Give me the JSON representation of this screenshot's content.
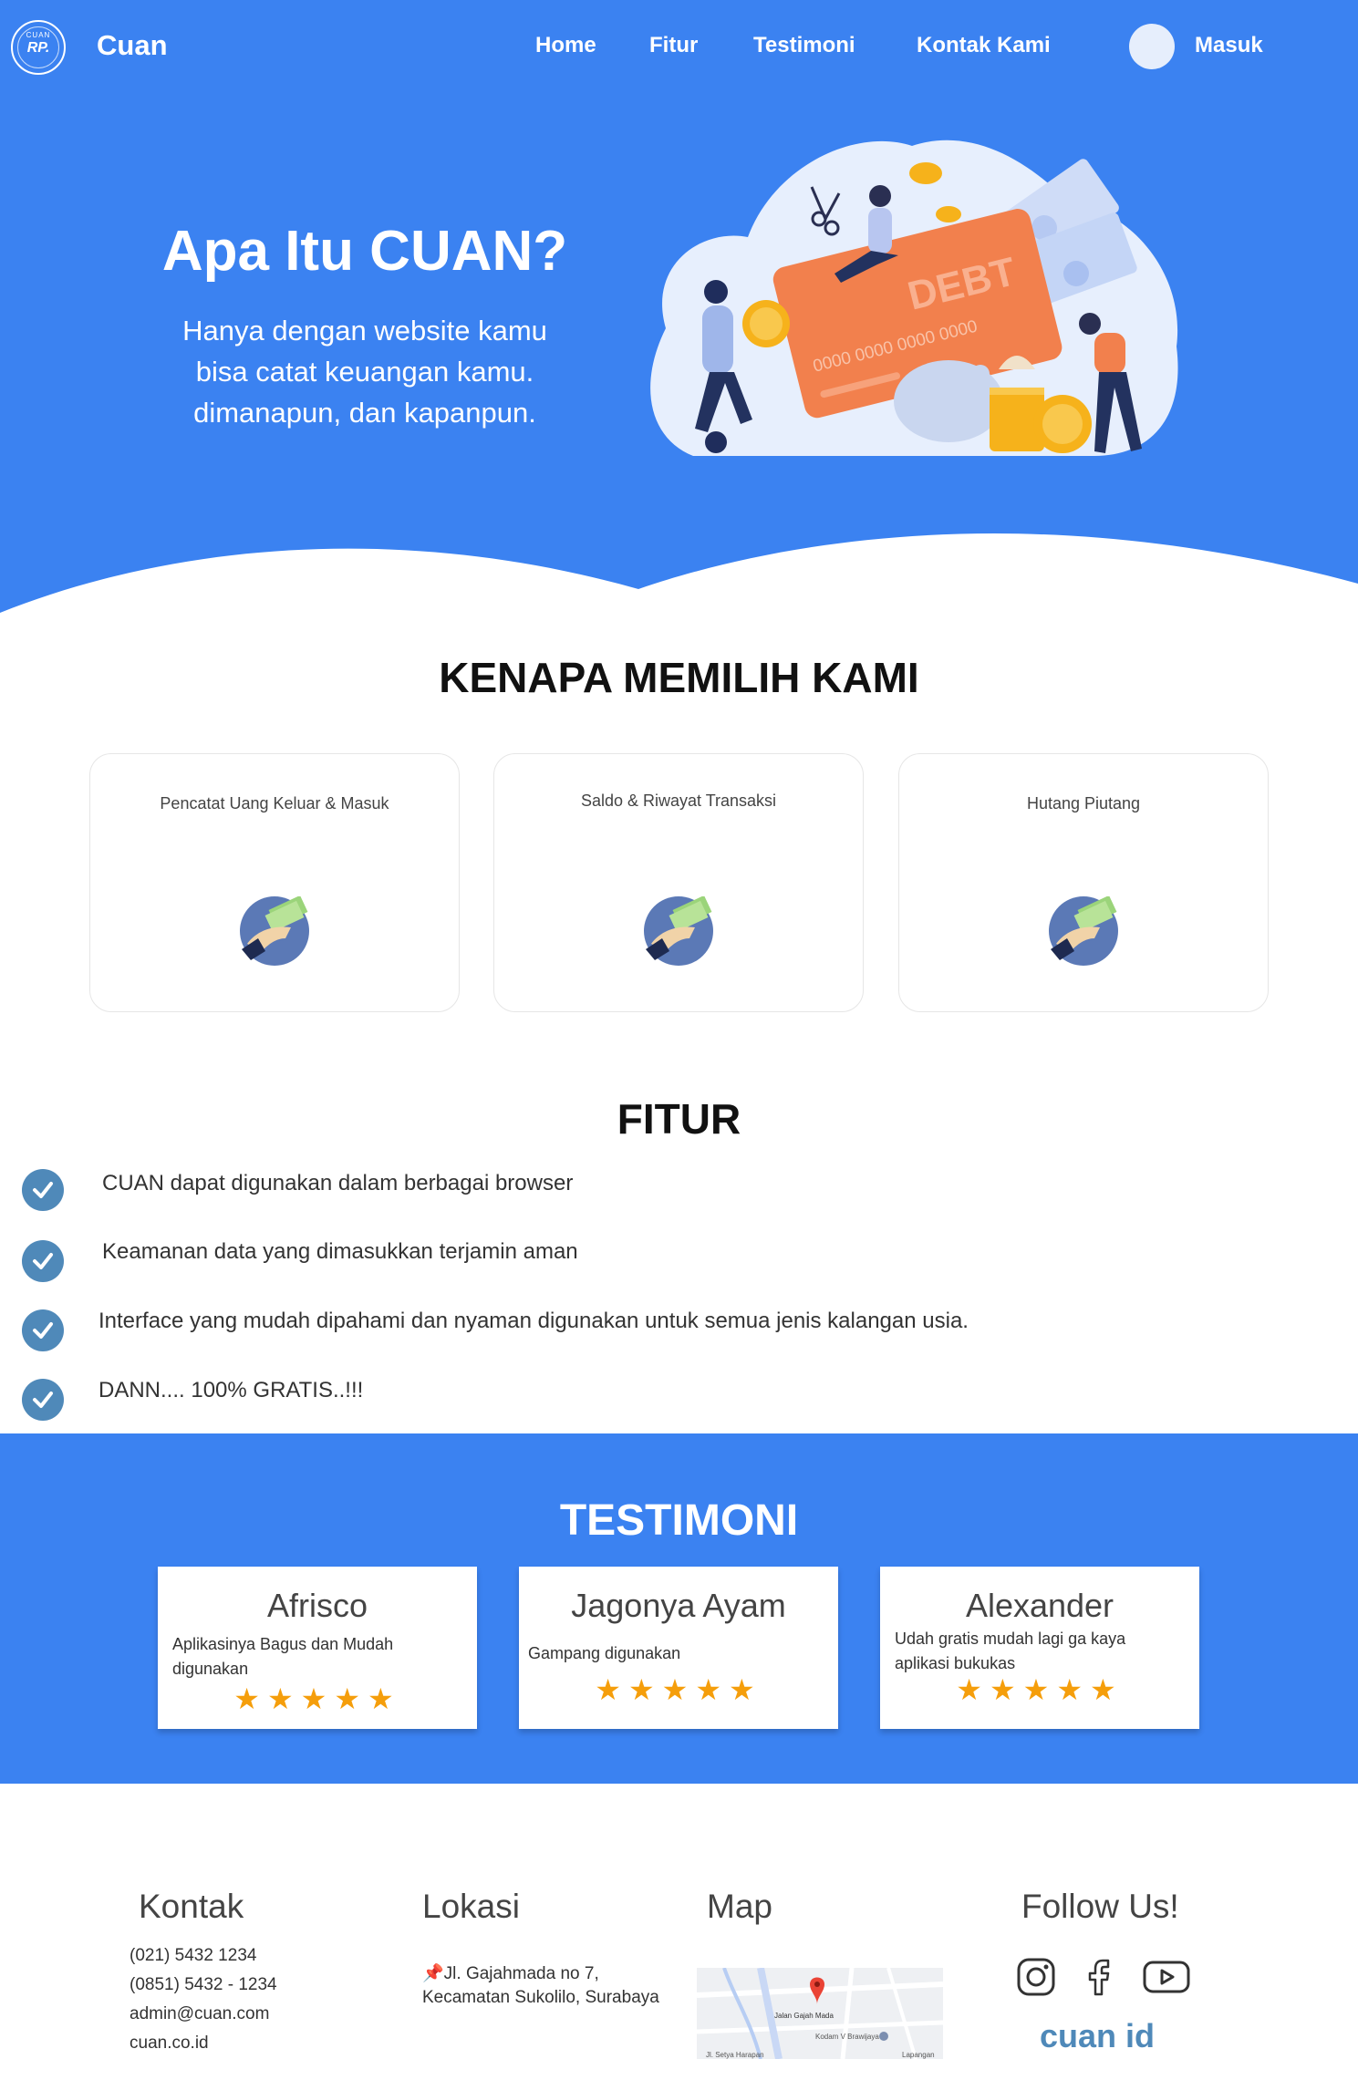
{
  "nav": {
    "logo_top": "CUAN",
    "logo_mid": "RP.",
    "brand": "Cuan",
    "links": [
      "Home",
      "Fitur",
      "Testimoni",
      "Kontak Kami"
    ],
    "login": "Masuk"
  },
  "hero": {
    "title": "Apa Itu CUAN?",
    "lines": [
      "Hanya dengan website kamu",
      "bisa catat keuangan kamu.",
      "dimanapun, dan kapanpun."
    ],
    "card_text": "DEBT",
    "card_number": "0000 0000 0000 0000"
  },
  "why": {
    "title": "KENAPA MEMILIH KAMI",
    "cards": [
      "Pencatat Uang Keluar & Masuk",
      "Saldo & Riwayat Transaksi",
      "Hutang Piutang"
    ]
  },
  "fitur": {
    "title": "FITUR",
    "items": [
      "CUAN dapat digunakan dalam berbagai browser",
      "Keamanan data yang dimasukkan terjamin aman",
      "Interface yang mudah dipahami dan nyaman digunakan untuk semua jenis kalangan usia.",
      "DANN.... 100% GRATIS..!!!"
    ]
  },
  "testimoni": {
    "title": "TESTIMONI",
    "cards": [
      {
        "name": "Afrisco",
        "review": "Aplikasinya Bagus dan Mudah digunakan",
        "stars": "★★★★★",
        "rating": 5
      },
      {
        "name": "Jagonya Ayam",
        "review": "Gampang digunakan",
        "stars": "★★★★★",
        "rating": 5
      },
      {
        "name": "Alexander",
        "review": "Udah gratis mudah lagi ga kaya aplikasi bukukas",
        "stars": "★★★★★",
        "rating": 5
      }
    ]
  },
  "footer": {
    "kontak": {
      "title": "Kontak",
      "lines": [
        "(021) 5432 1234",
        "(0851) 5432 - 1234",
        "admin@cuan.com",
        "cuan.co.id"
      ]
    },
    "lokasi": {
      "title": "Lokasi",
      "pin": "📌",
      "lines": [
        "Jl. Gajahmada no 7,",
        "Kecamatan Sukolilo, Surabaya"
      ]
    },
    "map": {
      "title": "Map",
      "labels": [
        "Jalan Gajah Mada",
        "Kodam V Brawijaya",
        "Jl. Setya Harapan",
        "Lapangan"
      ]
    },
    "follow": {
      "title": "Follow Us!",
      "handle": "cuan id"
    }
  },
  "colors": {
    "primary": "#3b82f1",
    "check": "#4f89b9",
    "star": "#f59e0b"
  },
  "icons": [
    "instagram-icon",
    "facebook-icon",
    "youtube-icon",
    "check-icon",
    "money-hand-icon",
    "map-pin-icon"
  ]
}
